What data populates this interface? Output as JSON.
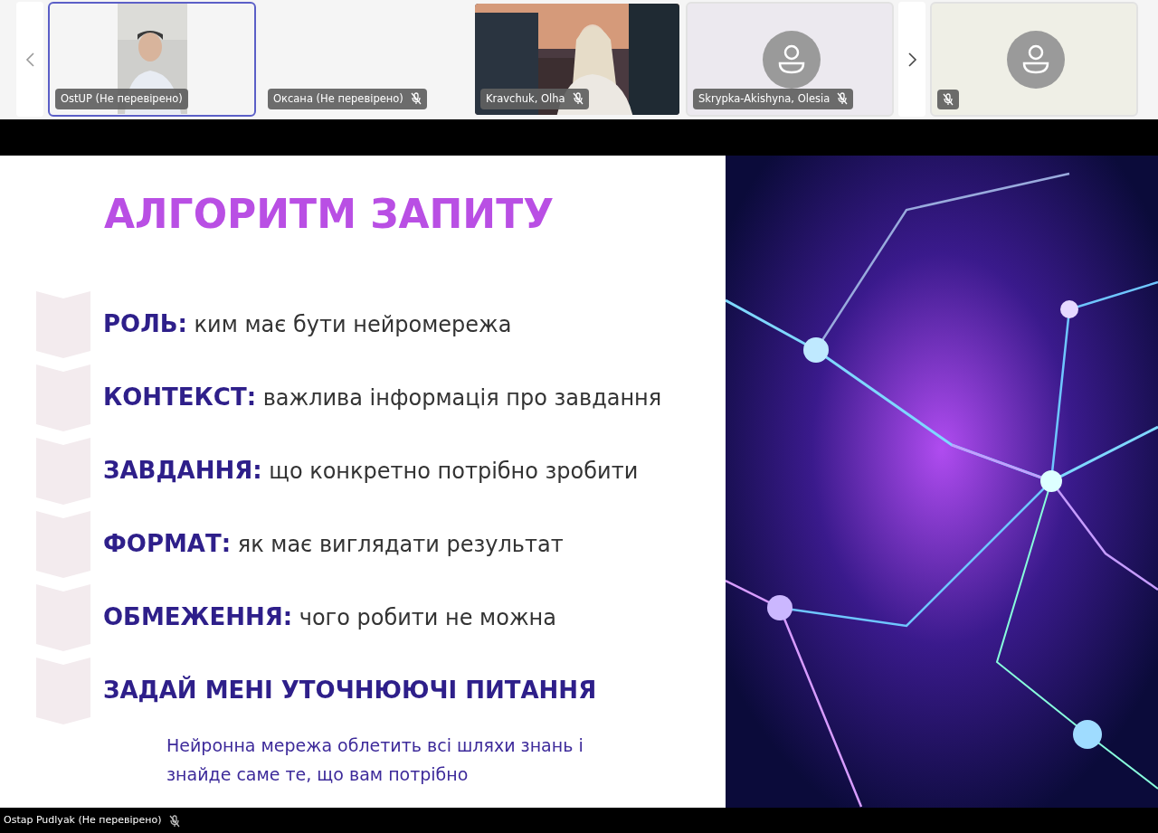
{
  "participants": [
    {
      "kind": "video",
      "name": "OstUP (Не перевірено)",
      "muted": false,
      "selected": true
    },
    {
      "kind": "blank",
      "name": "Оксана (Не перевірено)",
      "muted": true,
      "selected": false
    },
    {
      "kind": "video",
      "name": "Kravchuk, Olha",
      "muted": true,
      "selected": false
    },
    {
      "kind": "avatar",
      "name": "Skrypka-Akishyna, Olesia",
      "muted": true,
      "selected": false
    },
    {
      "kind": "avatar",
      "muted": true,
      "selected": false
    }
  ],
  "slide": {
    "title": "АЛГОРИТМ ЗАПИТУ",
    "items": [
      {
        "term": "РОЛЬ:",
        "desc": "ким має бути нейромережа"
      },
      {
        "term": "КОНТЕКСТ:",
        "desc": "важлива інформація про завдання"
      },
      {
        "term": "ЗАВДАННЯ:",
        "desc": "що конкретно потрібно зробити"
      },
      {
        "term": "ФОРМАТ:",
        "desc": "як має виглядати результат"
      },
      {
        "term": "ОБМЕЖЕННЯ:",
        "desc": "чого робити не можна"
      },
      {
        "term": "ЗАДАЙ МЕНІ УТОЧНЮЮЧІ ПИТАННЯ"
      }
    ],
    "caption": [
      "Нейронна мережа облетить всі шляхи знань і",
      "знайде саме те, що вам потрібно"
    ]
  },
  "presenter": {
    "name": "Ostap Pudlyak (Не перевірено)",
    "muted": true
  }
}
